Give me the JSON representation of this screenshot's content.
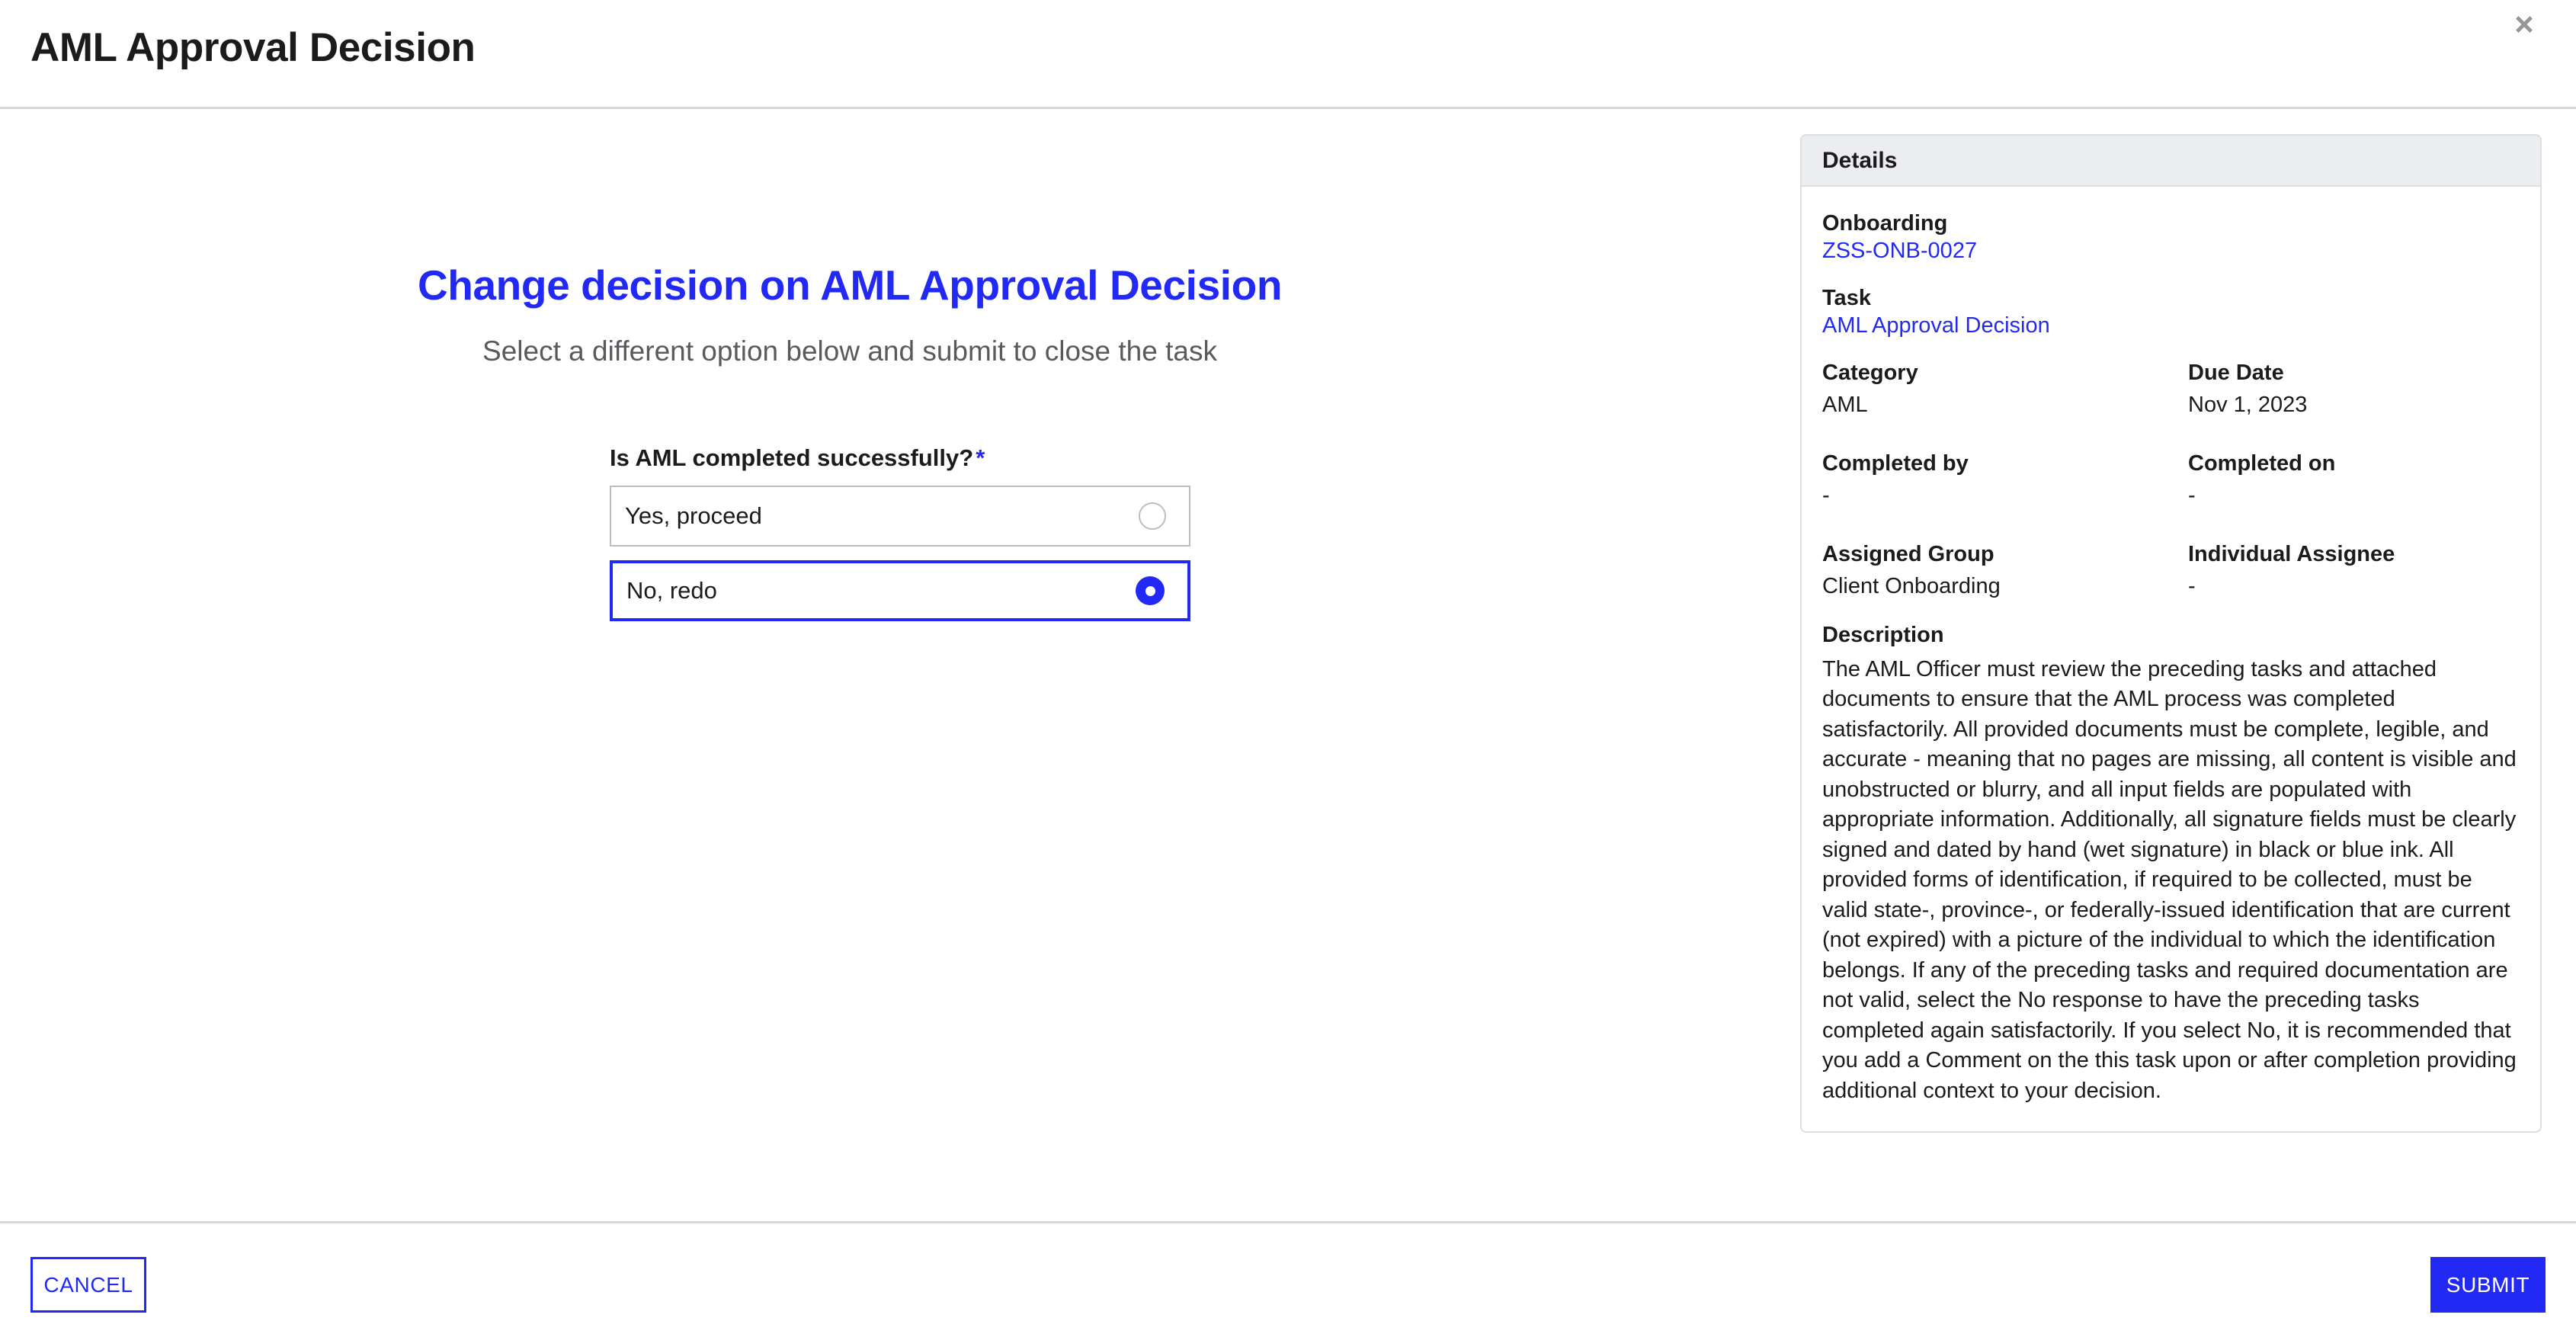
{
  "header": {
    "title": "AML Approval Decision",
    "close_icon": "close-icon"
  },
  "form": {
    "heading": "Change decision on AML Approval Decision",
    "subheading": "Select a different option below and submit to close the task",
    "question": {
      "label": "Is AML completed successfully?",
      "required_marker": "*",
      "options": [
        {
          "label": "Yes, proceed",
          "selected": false
        },
        {
          "label": "No, redo",
          "selected": true
        }
      ]
    }
  },
  "details": {
    "panel_title": "Details",
    "onboarding_label": "Onboarding",
    "onboarding_value": "ZSS-ONB-0027",
    "task_label": "Task",
    "task_value": "AML Approval Decision",
    "category_label": "Category",
    "category_value": "AML",
    "due_date_label": "Due Date",
    "due_date_value": "Nov 1, 2023",
    "completed_by_label": "Completed by",
    "completed_by_value": "-",
    "completed_on_label": "Completed on",
    "completed_on_value": "-",
    "assigned_group_label": "Assigned Group",
    "assigned_group_value": "Client Onboarding",
    "individual_assignee_label": "Individual Assignee",
    "individual_assignee_value": "-",
    "description_label": "Description",
    "description_text": "The AML Officer must review the preceding tasks and attached documents to ensure that the AML process was completed satisfactorily. All provided documents must be complete, legible, and accurate - meaning that no pages are missing, all content is visible and unobstructed or blurry, and all input fields are populated with appropriate information. Additionally, all signature fields must be clearly signed and dated by hand (wet signature) in black or blue ink. All provided forms of identification, if required to be collected, must be valid state-, province-, or federally-issued identification that are current (not expired) with a picture of the individual to which the identification belongs. If any of the preceding tasks and required documentation are not valid, select the No response to have the preceding tasks completed again satisfactorily. If you select No, it is recommended that you add a Comment on the this task upon or after completion providing additional context to your decision."
  },
  "footer": {
    "cancel_label": "CANCEL",
    "submit_label": "SUBMIT"
  },
  "colors": {
    "accent": "#2329f5",
    "text": "#1b1b1b",
    "muted_text": "#59595e",
    "border": "#d8d8d8",
    "panel_header_bg": "#ebedf0",
    "panel_border": "#dcdee1",
    "close_icon": "#969696"
  }
}
